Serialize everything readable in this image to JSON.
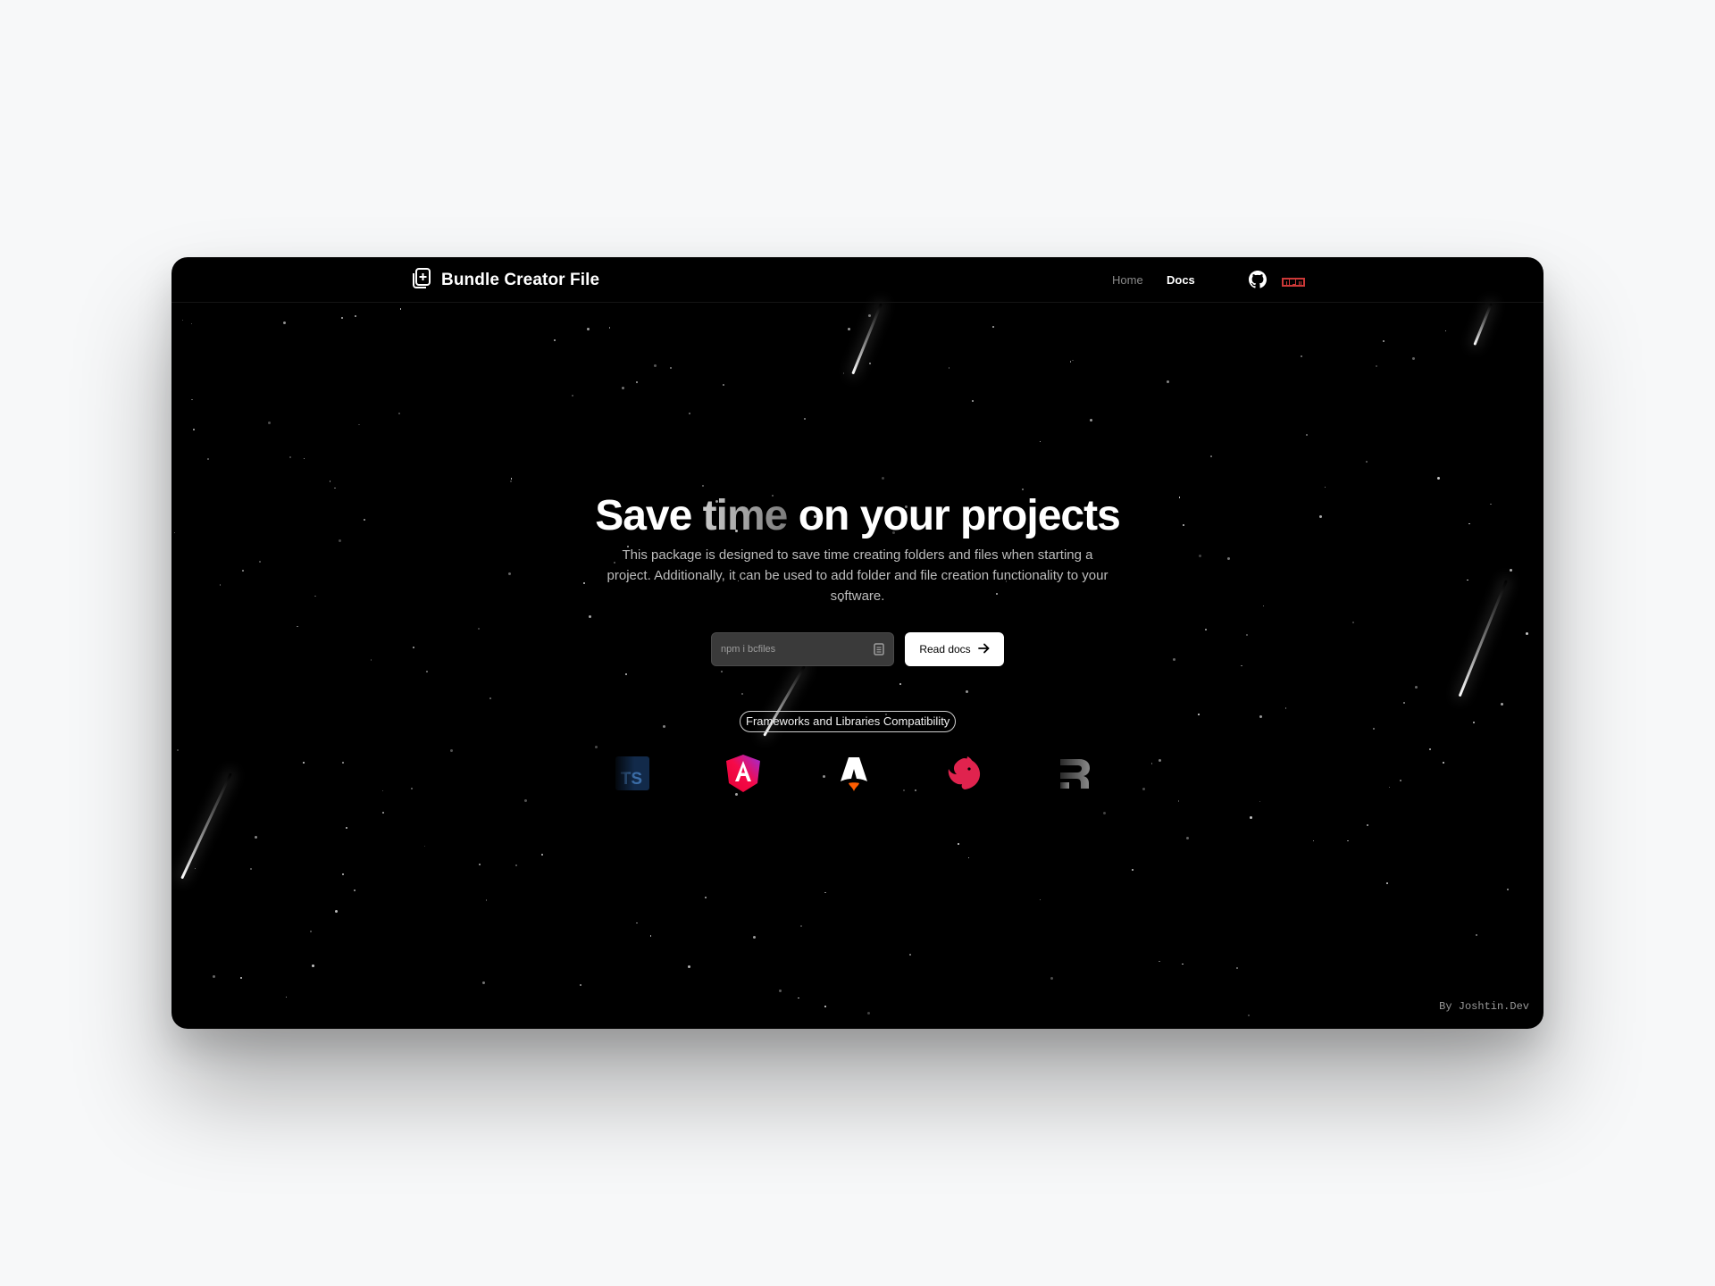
{
  "nav": {
    "brand": "Bundle Creator File",
    "links": [
      {
        "label": "Home"
      },
      {
        "label": "Docs"
      }
    ],
    "icons": [
      "github-icon",
      "npm-icon"
    ],
    "npm_label": "npm"
  },
  "hero": {
    "headline_part1": "Save",
    "headline_muted": "time",
    "headline_part2": "on your projects",
    "description": "This package is designed to save time creating folders and files when starting a project. Additionally, it can be used to add folder and file creation functionality to your software.",
    "install_placeholder": "npm i bcfiles",
    "read_docs_label": "Read docs",
    "compat_label": "Frameworks and Libraries Compatibility",
    "logos": [
      {
        "name": "typescript",
        "text": "TS"
      },
      {
        "name": "angular"
      },
      {
        "name": "astro"
      },
      {
        "name": "nestjs"
      },
      {
        "name": "remix"
      }
    ]
  },
  "footer": {
    "credit": "By Joshtin.Dev"
  },
  "colors": {
    "background": "#000000",
    "npm_red": "#cb3837",
    "angular_magenta": "#e40035",
    "nest_red": "#e0234e",
    "astro_orange": "#ff5d01"
  }
}
